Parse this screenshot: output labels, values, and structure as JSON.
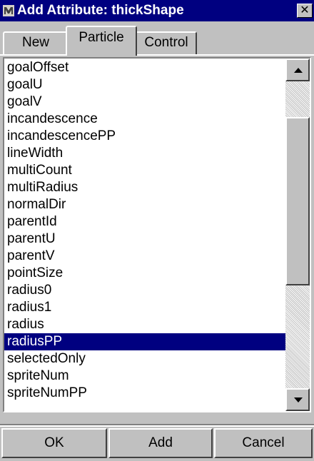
{
  "window": {
    "title": "Add Attribute: thickShape",
    "close_label": "✕",
    "icon": "maya-app-icon"
  },
  "tabs": [
    {
      "label": "New",
      "active": false
    },
    {
      "label": "Particle",
      "active": true
    },
    {
      "label": "Control",
      "active": false
    }
  ],
  "list": {
    "items": [
      "goalOffset",
      "goalU",
      "goalV",
      "incandescence",
      "incandescencePP",
      "lineWidth",
      "multiCount",
      "multiRadius",
      "normalDir",
      "parentId",
      "parentU",
      "parentV",
      "pointSize",
      "radius0",
      "radius1",
      "radius",
      "radiusPP",
      "selectedOnly",
      "spriteNum",
      "spriteNumPP"
    ],
    "selected": "radiusPP"
  },
  "buttons": {
    "ok": "OK",
    "add": "Add",
    "cancel": "Cancel"
  },
  "colors": {
    "titlebar": "#000080",
    "selection": "#000080",
    "face": "#c0c0c0"
  }
}
